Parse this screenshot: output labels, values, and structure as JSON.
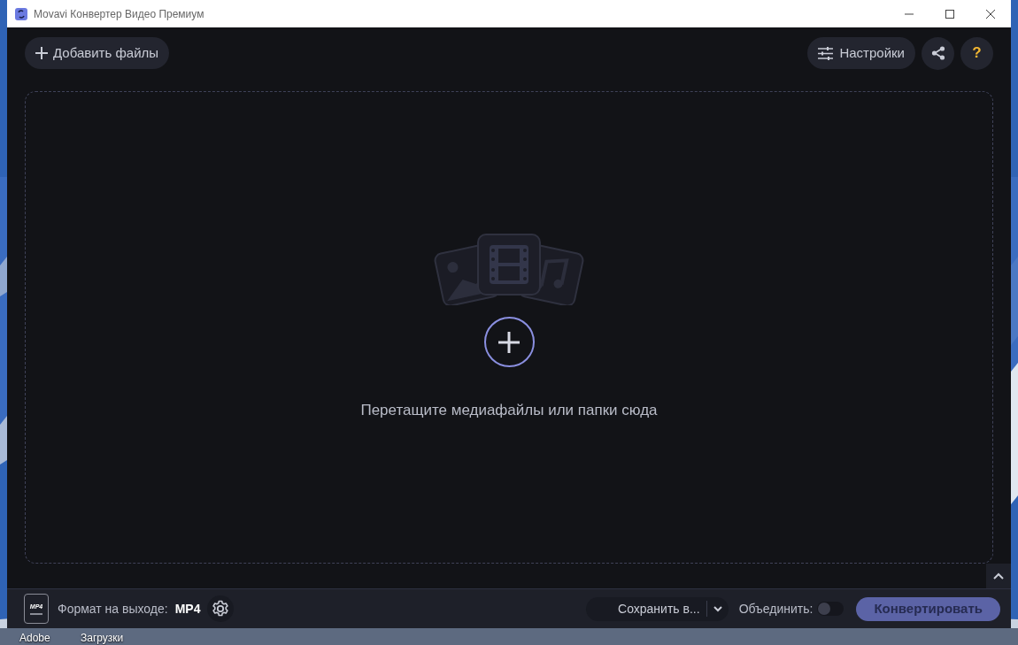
{
  "window": {
    "title": "Movavi Конвертер Видео Премиум"
  },
  "toolbar": {
    "add_files": "Добавить файлы",
    "settings": "Настройки",
    "help": "?"
  },
  "drop_zone": {
    "hint": "Перетащите медиафайлы или папки сюда"
  },
  "bottom_bar": {
    "format_icon_label": "MP4",
    "format_label": "Формат на выходе:",
    "format_value": "MP4",
    "save_to": "Сохранить в...",
    "merge": {
      "label": "Объединить:",
      "on": false
    },
    "convert": "Конвертировать"
  },
  "desktop": {
    "icons": [
      "Adobe",
      "Загрузки"
    ]
  }
}
